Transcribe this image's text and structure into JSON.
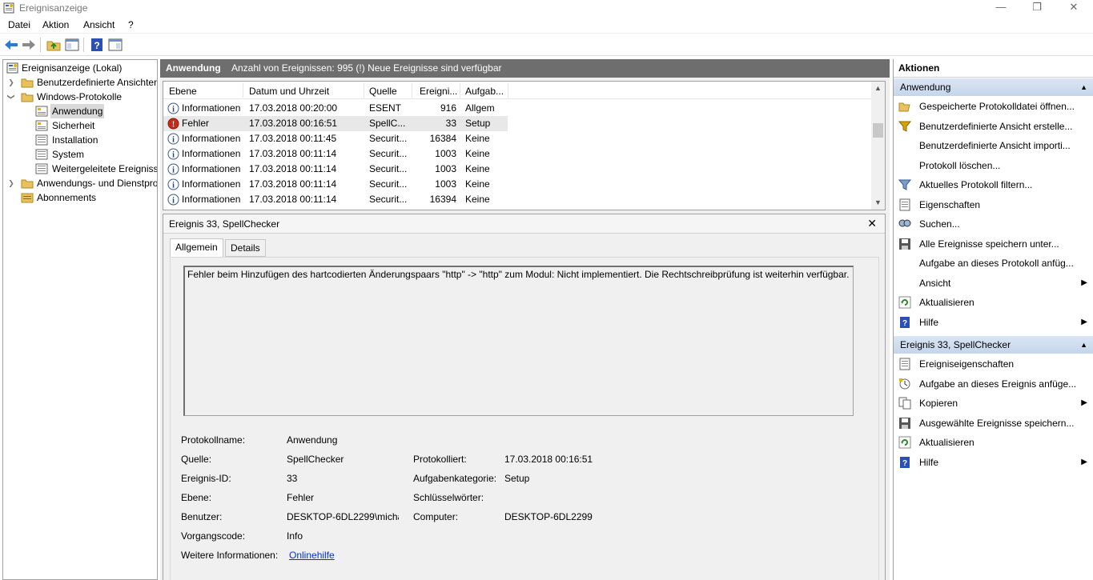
{
  "window": {
    "title": "Ereignisanzeige",
    "minimize": "—",
    "maximize": "❐",
    "close": "✕"
  },
  "menu": {
    "file": "Datei",
    "action": "Aktion",
    "view": "Ansicht",
    "help": "?"
  },
  "tree": {
    "root": "Ereignisanzeige (Lokal)",
    "custom_views": "Benutzerdefinierte Ansichten",
    "windows_logs": "Windows-Protokolle",
    "application": "Anwendung",
    "security": "Sicherheit",
    "setup": "Installation",
    "system": "System",
    "forwarded": "Weitergeleitete Ereignisse",
    "app_service_logs": "Anwendungs- und Dienstprotokolle",
    "subscriptions": "Abonnements"
  },
  "center": {
    "title": "Anwendung",
    "info": "Anzahl von Ereignissen: 995 (!) Neue Ereignisse sind verfügbar"
  },
  "columns": {
    "level": "Ebene",
    "datetime": "Datum und Uhrzeit",
    "source": "Quelle",
    "eventid": "Ereigni...",
    "task": "Aufgab..."
  },
  "events": [
    {
      "level": "Informationen",
      "datetime": "17.03.2018 00:20:00",
      "source": "ESENT",
      "id": "916",
      "task": "Allgem",
      "type": "info"
    },
    {
      "level": "Fehler",
      "datetime": "17.03.2018 00:16:51",
      "source": "SpellC...",
      "id": "33",
      "task": "Setup",
      "type": "error"
    },
    {
      "level": "Informationen",
      "datetime": "17.03.2018 00:11:45",
      "source": "Securit...",
      "id": "16384",
      "task": "Keine",
      "type": "info"
    },
    {
      "level": "Informationen",
      "datetime": "17.03.2018 00:11:14",
      "source": "Securit...",
      "id": "1003",
      "task": "Keine",
      "type": "info"
    },
    {
      "level": "Informationen",
      "datetime": "17.03.2018 00:11:14",
      "source": "Securit...",
      "id": "1003",
      "task": "Keine",
      "type": "info"
    },
    {
      "level": "Informationen",
      "datetime": "17.03.2018 00:11:14",
      "source": "Securit...",
      "id": "1003",
      "task": "Keine",
      "type": "info"
    },
    {
      "level": "Informationen",
      "datetime": "17.03.2018 00:11:14",
      "source": "Securit...",
      "id": "16394",
      "task": "Keine",
      "type": "info"
    }
  ],
  "detail": {
    "title": "Ereignis 33, SpellChecker",
    "close": "✕",
    "tab_general": "Allgemein",
    "tab_details": "Details",
    "message": "Fehler beim Hinzufügen des hartcodierten Änderungspaars \"http\" -> \"http\" zum Modul: Nicht implementiert. Die Rechtschreibprüfung ist weiterhin verfügbar.",
    "log_name_label": "Protokollname:",
    "log_name": "Anwendung",
    "source_label": "Quelle:",
    "source": "SpellChecker",
    "logged_label": "Protokolliert:",
    "logged": "17.03.2018 00:16:51",
    "event_id_label": "Ereignis-ID:",
    "event_id": "33",
    "task_category_label": "Aufgabenkategorie:",
    "task_category": "Setup",
    "level_label": "Ebene:",
    "level": "Fehler",
    "keywords_label": "Schlüsselwörter:",
    "keywords": "",
    "user_label": "Benutzer:",
    "user": "DESKTOP-6DL2299\\micha",
    "computer_label": "Computer:",
    "computer": "DESKTOP-6DL2299",
    "opcode_label": "Vorgangscode:",
    "opcode": "Info",
    "more_info_label": "Weitere Informationen:",
    "more_info": "Onlinehilfe"
  },
  "actions": {
    "title": "Aktionen",
    "section1": "Anwendung",
    "items1": [
      "Gespeicherte Protokolldatei öffnen...",
      "Benutzerdefinierte Ansicht erstelle...",
      "Benutzerdefinierte Ansicht importi...",
      "Protokoll löschen...",
      "Aktuelles Protokoll filtern...",
      "Eigenschaften",
      "Suchen...",
      "Alle Ereignisse speichern unter...",
      "Aufgabe an dieses Protokoll anfüg...",
      "Ansicht",
      "Aktualisieren",
      "Hilfe"
    ],
    "section2": "Ereignis 33, SpellChecker",
    "items2": [
      "Ereigniseigenschaften",
      "Aufgabe an dieses Ereignis anfüge...",
      "Kopieren",
      "Ausgewählte Ereignisse speichern...",
      "Aktualisieren",
      "Hilfe"
    ]
  }
}
